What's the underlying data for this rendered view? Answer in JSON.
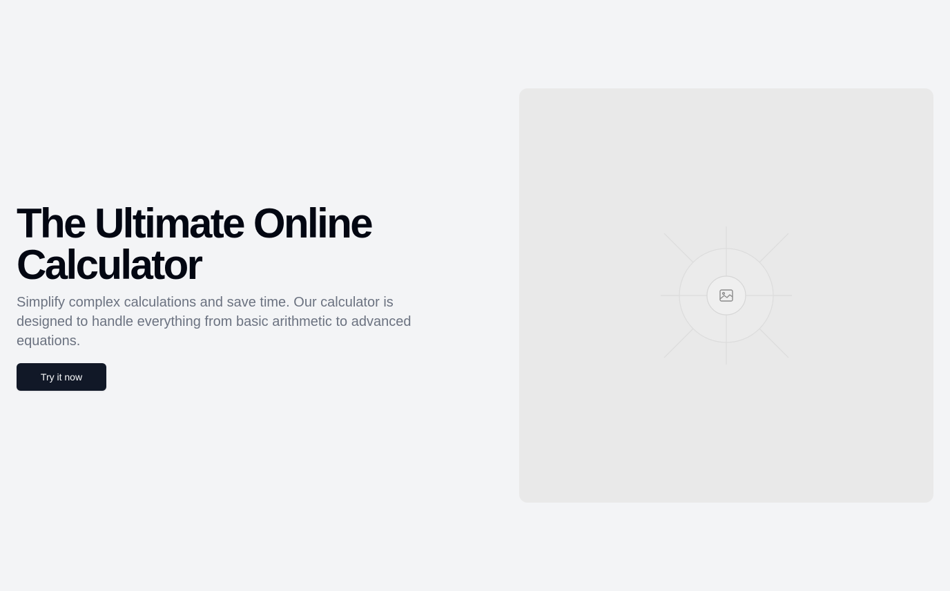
{
  "hero": {
    "title": "The Ultimate Online Calculator",
    "subtitle": "Simplify complex calculations and save time. Our calculator is designed to handle everything from basic arithmetic to advanced equations.",
    "cta_label": "Try it now"
  },
  "media": {
    "icon": "image-icon"
  },
  "colors": {
    "background": "#f3f4f6",
    "title": "#030712",
    "subtitle": "#6b7280",
    "button_bg": "#111827",
    "button_text": "#f9fafb",
    "placeholder_bg": "#e9e9e9"
  }
}
